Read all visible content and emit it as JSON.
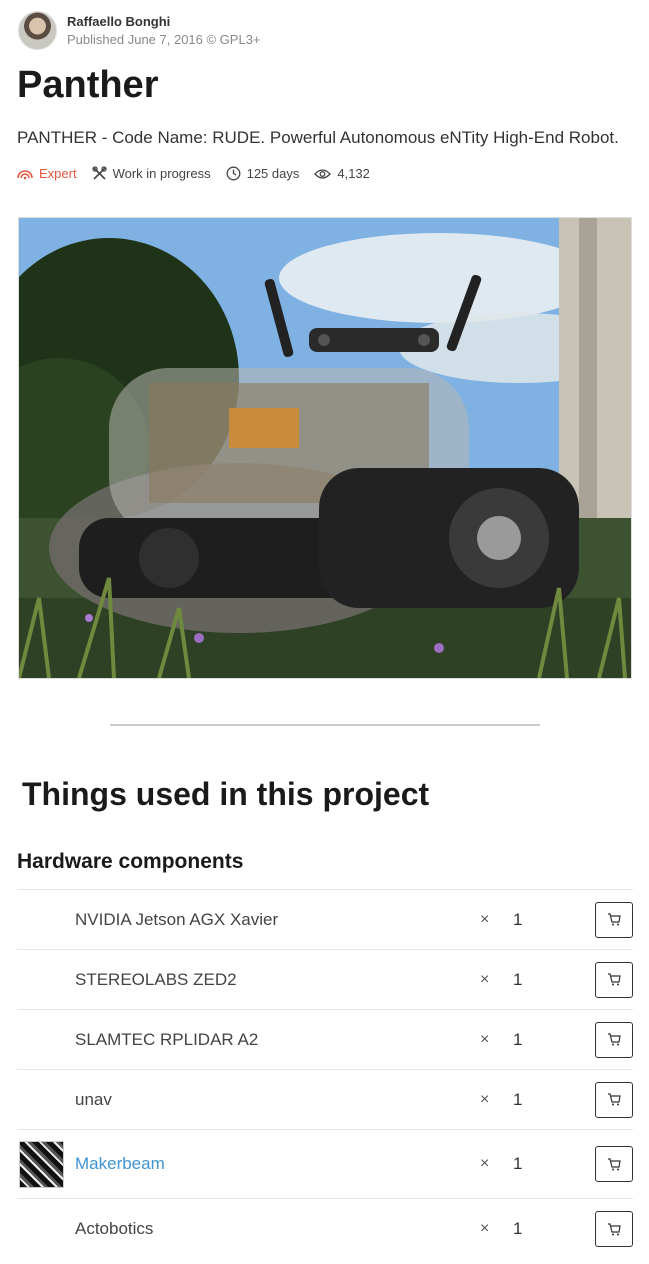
{
  "author": {
    "name": "Raffaello Bonghi",
    "published": "Published June 7, 2016 © GPL3+"
  },
  "project": {
    "title": "Panther",
    "subtitle": "PANTHER - Code Name: RUDE. Powerful Autonomous eNTity High-End Robot."
  },
  "stats": {
    "difficulty": "Expert",
    "status": "Work in progress",
    "duration": "125 days",
    "views": "4,132"
  },
  "section_title": "Things used in this project",
  "hardware": {
    "title": "Hardware components",
    "times_symbol": "×",
    "items": [
      {
        "name": "NVIDIA Jetson AGX Xavier",
        "qty": "1"
      },
      {
        "name": "STEREOLABS ZED2",
        "qty": "1"
      },
      {
        "name": "SLAMTEC RPLIDAR A2",
        "qty": "1"
      },
      {
        "name": "unav",
        "qty": "1"
      },
      {
        "name": "Makerbeam",
        "qty": "1"
      },
      {
        "name": "Actobotics",
        "qty": "1"
      }
    ]
  },
  "colors": {
    "expert": "#e3563f",
    "link": "#3f94d1"
  }
}
